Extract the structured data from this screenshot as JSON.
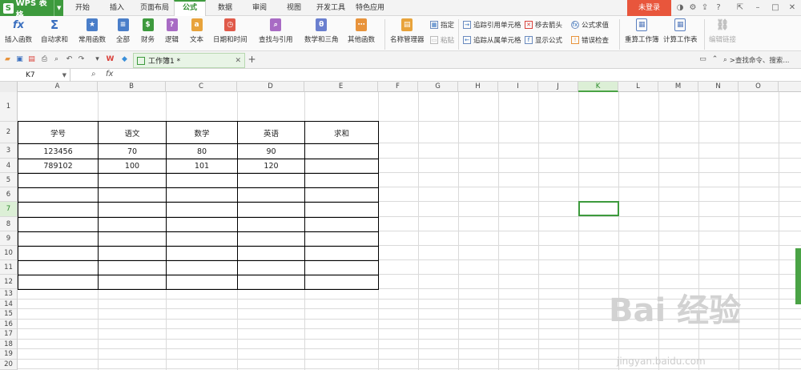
{
  "app": {
    "name": "WPS 表格",
    "logo_letter": "S"
  },
  "menu_tabs": [
    "开始",
    "插入",
    "页面布局",
    "公式",
    "数据",
    "审阅",
    "视图",
    "开发工具",
    "特色应用"
  ],
  "active_tab": "公式",
  "login_label": "未登录",
  "ribbon": {
    "insert_function": "插入函数",
    "autosum": "自动求和",
    "common": "常用函数",
    "all": "全部",
    "finance": "财务",
    "logic": "逻辑",
    "text": "文本",
    "datetime": "日期和时间",
    "lookup": "查找与引用",
    "math": "数学和三角",
    "other": "其他函数",
    "name_manager": "名称管理器",
    "specify": "指定",
    "paste": "粘贴",
    "trace_precedents": "追踪引用单元格",
    "trace_dependents": "追踪从属单元格",
    "remove_arrows": "移去箭头",
    "show_formulas": "显示公式",
    "evaluate": "公式求值",
    "error_check": "错误检查",
    "recalc_book": "重算工作簿",
    "calc_sheet": "计算工作表",
    "edit_links": "编辑链接"
  },
  "workbook_tab": "工作簿1 *",
  "search_placeholder": ">查找命令、搜索...",
  "namebox": "K7",
  "fx_label": "fx",
  "columns": [
    "A",
    "B",
    "C",
    "D",
    "E",
    "F",
    "G",
    "H",
    "I",
    "J",
    "K",
    "L",
    "M",
    "N",
    "O"
  ],
  "selected_column": "K",
  "rows": [
    "1",
    "2",
    "3",
    "4",
    "5",
    "6",
    "7",
    "8",
    "9",
    "10",
    "11",
    "12",
    "13",
    "14",
    "15",
    "16",
    "17",
    "18",
    "19",
    "20"
  ],
  "selected_row": "7",
  "table": {
    "headers": [
      "学号",
      "语文",
      "数学",
      "英语",
      "求和"
    ],
    "rows": [
      [
        "123456",
        "70",
        "80",
        "90",
        ""
      ],
      [
        "789102",
        "100",
        "101",
        "120",
        ""
      ]
    ]
  },
  "watermark": {
    "main": "Bai 经验",
    "sub": "jingyan.baidu.com"
  }
}
